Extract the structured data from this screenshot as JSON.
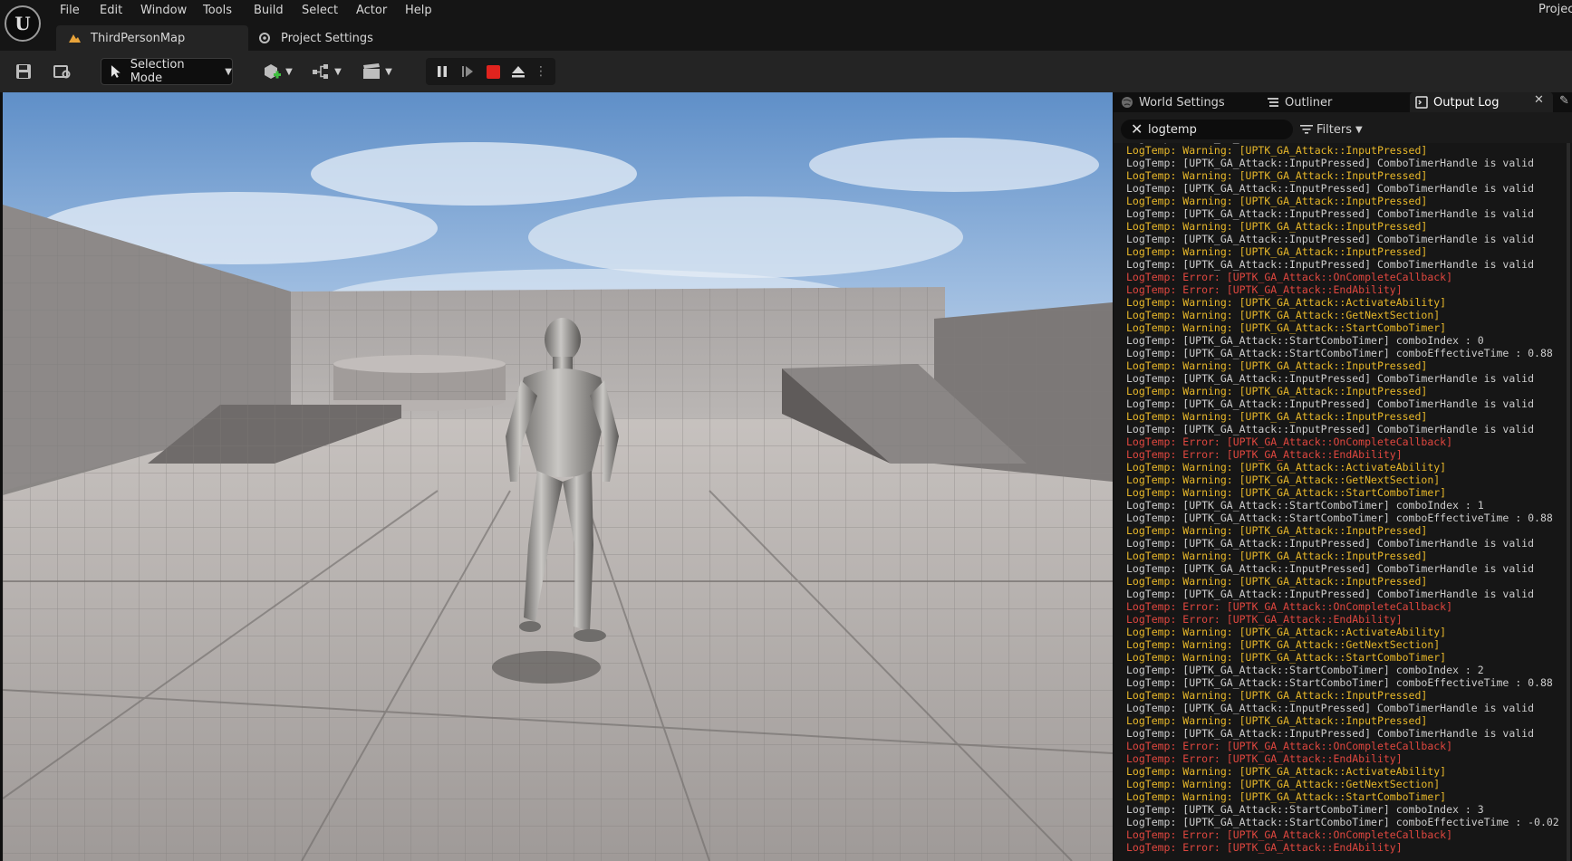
{
  "menu": [
    "File",
    "Edit",
    "Window",
    "Tools",
    "Build",
    "Select",
    "Actor",
    "Help"
  ],
  "project_label": "Projec",
  "tabs": {
    "map": "ThirdPersonMap",
    "settings": "Project Settings"
  },
  "toolbar": {
    "selection_mode": "Selection Mode",
    "stop_color": "#e0231e"
  },
  "panel": {
    "tabs": [
      "World Settings",
      "Outliner",
      "Output Log"
    ],
    "active_tab": "Output Log",
    "search_value": "logtemp",
    "filters_label": "Filters"
  },
  "log": [
    {
      "level": "log",
      "text": "LogTemp: [UPTK_GA_Attack::StartComboTimer] comboEffectiveTime : 0.88"
    },
    {
      "level": "warning",
      "text": "LogTemp: Warning: [UPTK_GA_Attack::InputPressed]"
    },
    {
      "level": "log",
      "text": "LogTemp: [UPTK_GA_Attack::InputPressed] ComboTimerHandle is valid"
    },
    {
      "level": "warning",
      "text": "LogTemp: Warning: [UPTK_GA_Attack::InputPressed]"
    },
    {
      "level": "log",
      "text": "LogTemp: [UPTK_GA_Attack::InputPressed] ComboTimerHandle is valid"
    },
    {
      "level": "warning",
      "text": "LogTemp: Warning: [UPTK_GA_Attack::InputPressed]"
    },
    {
      "level": "log",
      "text": "LogTemp: [UPTK_GA_Attack::InputPressed] ComboTimerHandle is valid"
    },
    {
      "level": "warning",
      "text": "LogTemp: Warning: [UPTK_GA_Attack::InputPressed]"
    },
    {
      "level": "log",
      "text": "LogTemp: [UPTK_GA_Attack::InputPressed] ComboTimerHandle is valid"
    },
    {
      "level": "warning",
      "text": "LogTemp: Warning: [UPTK_GA_Attack::InputPressed]"
    },
    {
      "level": "log",
      "text": "LogTemp: [UPTK_GA_Attack::InputPressed] ComboTimerHandle is valid"
    },
    {
      "level": "error",
      "text": "LogTemp: Error: [UPTK_GA_Attack::OnCompleteCallback]"
    },
    {
      "level": "error",
      "text": "LogTemp: Error: [UPTK_GA_Attack::EndAbility]"
    },
    {
      "level": "warning",
      "text": "LogTemp: Warning: [UPTK_GA_Attack::ActivateAbility]"
    },
    {
      "level": "warning",
      "text": "LogTemp: Warning: [UPTK_GA_Attack::GetNextSection]"
    },
    {
      "level": "warning",
      "text": "LogTemp: Warning: [UPTK_GA_Attack::StartComboTimer]"
    },
    {
      "level": "log",
      "text": "LogTemp: [UPTK_GA_Attack::StartComboTimer] comboIndex : 0"
    },
    {
      "level": "log",
      "text": "LogTemp: [UPTK_GA_Attack::StartComboTimer] comboEffectiveTime : 0.88"
    },
    {
      "level": "warning",
      "text": "LogTemp: Warning: [UPTK_GA_Attack::InputPressed]"
    },
    {
      "level": "log",
      "text": "LogTemp: [UPTK_GA_Attack::InputPressed] ComboTimerHandle is valid"
    },
    {
      "level": "warning",
      "text": "LogTemp: Warning: [UPTK_GA_Attack::InputPressed]"
    },
    {
      "level": "log",
      "text": "LogTemp: [UPTK_GA_Attack::InputPressed] ComboTimerHandle is valid"
    },
    {
      "level": "warning",
      "text": "LogTemp: Warning: [UPTK_GA_Attack::InputPressed]"
    },
    {
      "level": "log",
      "text": "LogTemp: [UPTK_GA_Attack::InputPressed] ComboTimerHandle is valid"
    },
    {
      "level": "error",
      "text": "LogTemp: Error: [UPTK_GA_Attack::OnCompleteCallback]"
    },
    {
      "level": "error",
      "text": "LogTemp: Error: [UPTK_GA_Attack::EndAbility]"
    },
    {
      "level": "warning",
      "text": "LogTemp: Warning: [UPTK_GA_Attack::ActivateAbility]"
    },
    {
      "level": "warning",
      "text": "LogTemp: Warning: [UPTK_GA_Attack::GetNextSection]"
    },
    {
      "level": "warning",
      "text": "LogTemp: Warning: [UPTK_GA_Attack::StartComboTimer]"
    },
    {
      "level": "log",
      "text": "LogTemp: [UPTK_GA_Attack::StartComboTimer] comboIndex : 1"
    },
    {
      "level": "log",
      "text": "LogTemp: [UPTK_GA_Attack::StartComboTimer] comboEffectiveTime : 0.88"
    },
    {
      "level": "warning",
      "text": "LogTemp: Warning: [UPTK_GA_Attack::InputPressed]"
    },
    {
      "level": "log",
      "text": "LogTemp: [UPTK_GA_Attack::InputPressed] ComboTimerHandle is valid"
    },
    {
      "level": "warning",
      "text": "LogTemp: Warning: [UPTK_GA_Attack::InputPressed]"
    },
    {
      "level": "log",
      "text": "LogTemp: [UPTK_GA_Attack::InputPressed] ComboTimerHandle is valid"
    },
    {
      "level": "warning",
      "text": "LogTemp: Warning: [UPTK_GA_Attack::InputPressed]"
    },
    {
      "level": "log",
      "text": "LogTemp: [UPTK_GA_Attack::InputPressed] ComboTimerHandle is valid"
    },
    {
      "level": "error",
      "text": "LogTemp: Error: [UPTK_GA_Attack::OnCompleteCallback]"
    },
    {
      "level": "error",
      "text": "LogTemp: Error: [UPTK_GA_Attack::EndAbility]"
    },
    {
      "level": "warning",
      "text": "LogTemp: Warning: [UPTK_GA_Attack::ActivateAbility]"
    },
    {
      "level": "warning",
      "text": "LogTemp: Warning: [UPTK_GA_Attack::GetNextSection]"
    },
    {
      "level": "warning",
      "text": "LogTemp: Warning: [UPTK_GA_Attack::StartComboTimer]"
    },
    {
      "level": "log",
      "text": "LogTemp: [UPTK_GA_Attack::StartComboTimer] comboIndex : 2"
    },
    {
      "level": "log",
      "text": "LogTemp: [UPTK_GA_Attack::StartComboTimer] comboEffectiveTime : 0.88"
    },
    {
      "level": "warning",
      "text": "LogTemp: Warning: [UPTK_GA_Attack::InputPressed]"
    },
    {
      "level": "log",
      "text": "LogTemp: [UPTK_GA_Attack::InputPressed] ComboTimerHandle is valid"
    },
    {
      "level": "warning",
      "text": "LogTemp: Warning: [UPTK_GA_Attack::InputPressed]"
    },
    {
      "level": "log",
      "text": "LogTemp: [UPTK_GA_Attack::InputPressed] ComboTimerHandle is valid"
    },
    {
      "level": "error",
      "text": "LogTemp: Error: [UPTK_GA_Attack::OnCompleteCallback]"
    },
    {
      "level": "error",
      "text": "LogTemp: Error: [UPTK_GA_Attack::EndAbility]"
    },
    {
      "level": "warning",
      "text": "LogTemp: Warning: [UPTK_GA_Attack::ActivateAbility]"
    },
    {
      "level": "warning",
      "text": "LogTemp: Warning: [UPTK_GA_Attack::GetNextSection]"
    },
    {
      "level": "warning",
      "text": "LogTemp: Warning: [UPTK_GA_Attack::StartComboTimer]"
    },
    {
      "level": "log",
      "text": "LogTemp: [UPTK_GA_Attack::StartComboTimer] comboIndex : 3"
    },
    {
      "level": "log",
      "text": "LogTemp: [UPTK_GA_Attack::StartComboTimer] comboEffectiveTime : -0.02"
    },
    {
      "level": "error",
      "text": "LogTemp: Error: [UPTK_GA_Attack::OnCompleteCallback]"
    },
    {
      "level": "error",
      "text": "LogTemp: Error: [UPTK_GA_Attack::EndAbility]"
    }
  ],
  "icons": {
    "logo": "unreal-logo-icon",
    "map_tab": "level-map-icon",
    "settings_tab": "settings-icon",
    "save": "save-icon",
    "browse": "content-browser-icon",
    "add_actor": "add-actor-icon",
    "blueprint": "blueprint-icon",
    "cinematics": "clapperboard-icon",
    "pause": "pause-icon",
    "step": "frame-skip-icon",
    "stop": "stop-icon",
    "eject": "eject-icon"
  }
}
